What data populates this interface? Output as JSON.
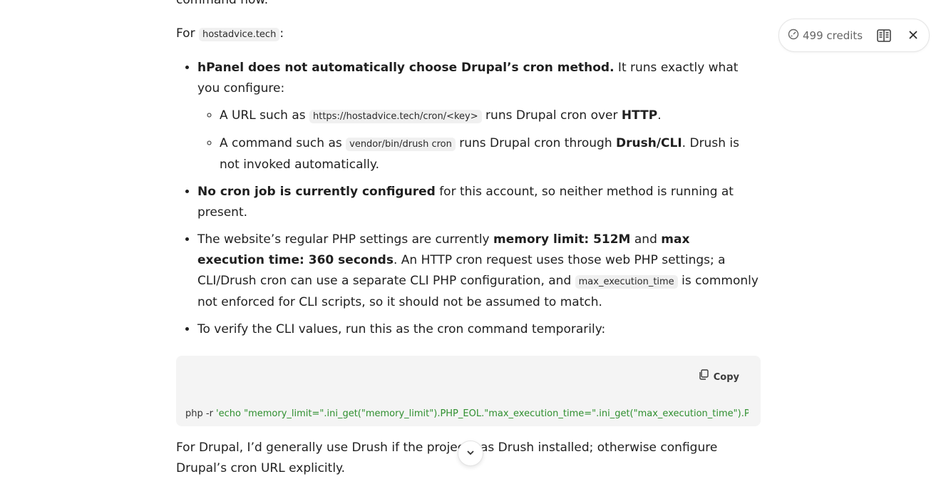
{
  "intro": {
    "line1_text": "command now."
  },
  "for_line": {
    "prefix": "For ",
    "domain": "hostadvice.tech",
    "suffix": ":"
  },
  "bullets": {
    "b1": {
      "bold": "hPanel does not automatically choose Drupal’s cron method.",
      "rest": " It runs exactly what you configure:",
      "sub1": {
        "pre": "A URL such as ",
        "code": "https://hostadvice.tech/cron/<key>",
        "mid": " runs Drupal cron over ",
        "bold": "HTTP",
        "post": "."
      },
      "sub2": {
        "pre": "A command such as ",
        "code": "vendor/bin/drush cron",
        "mid": " runs Drupal cron through ",
        "bold": "Drush/CLI",
        "post": ". Drush is not invoked automatically."
      }
    },
    "b2": {
      "bold": "No cron job is currently configured",
      "rest": " for this account, so neither method is running at present."
    },
    "b3": {
      "pre": "The website’s regular PHP settings are currently ",
      "bold1": "memory limit: 512M",
      "and": " and ",
      "bold2": "max execution time: 360 seconds",
      "mid": ". An HTTP cron request uses those web PHP settings; a CLI/Drush cron can use a separate CLI PHP configuration, and ",
      "code": "max_execution_time",
      "post": " is commonly not enforced for CLI scripts, so it should not be assumed to match."
    },
    "b4": {
      "text": "To verify the CLI values, run this as the cron command temporarily:"
    }
  },
  "codeblock": {
    "copy_label": "Copy",
    "cmd": "php -r ",
    "string": "'echo \"memory_limit=\".ini_get(\"memory_limit\").PHP_EOL.\"max_execution_time=\".ini_get(\"max_execution_time\").PHP_EOL;'"
  },
  "closing": {
    "text": "For Drupal, I’d generally use Drush if the project has Drush installed; otherwise configure Drupal’s cron URL explicitly."
  },
  "topbar": {
    "credits": "499 credits"
  },
  "icons": {
    "credits": "credits-gauge-icon",
    "reader": "reader-mode-icon",
    "close": "close-icon",
    "scroll": "chevron-down-icon",
    "copy": "copy-icon"
  },
  "colors": {
    "code_string": "#2f8f2f",
    "inline_code_bg": "#f0f0f0",
    "codeblock_bg": "#f4f4f4"
  }
}
